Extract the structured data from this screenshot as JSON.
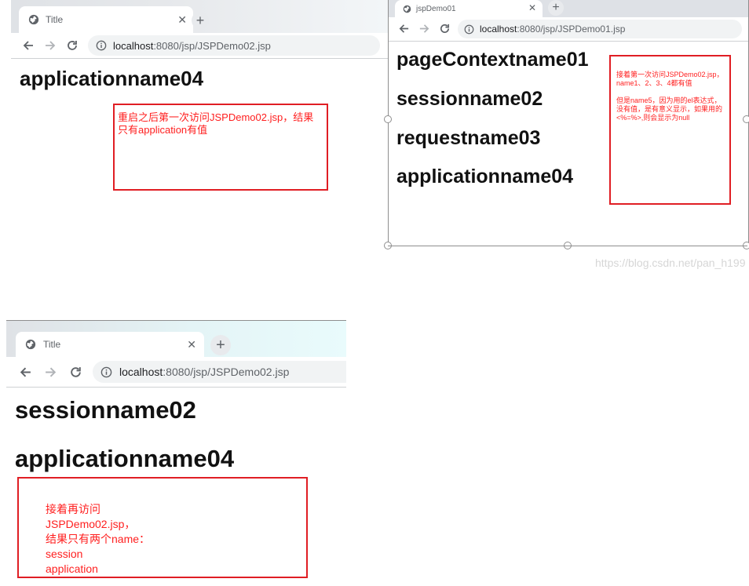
{
  "window_a": {
    "tab_title": "Title",
    "url_host": "localhost",
    "url_rest": ":8080/jsp/JSPDemo02.jsp",
    "headings": [
      "applicationname04"
    ],
    "note": "重启之后第一次访问JSPDemo02.jsp，结果只有application有值"
  },
  "window_b": {
    "tab_title": "jspDemo01",
    "url_host": "localhost",
    "url_rest": ":8080/jsp/JSPDemo01.jsp",
    "headings": [
      "pageContextname01",
      "sessionname02",
      "requestname03",
      "applicationname04"
    ],
    "note_line1": "接着第一次访问JSPDemo02.jsp，name1、2、3、4都有值",
    "note_line2": "但是name5，因为用的el表达式，没有值，是有意义显示，如果用的<%=%>,则会显示为null"
  },
  "window_c": {
    "tab_title": "Title",
    "url_host": "localhost",
    "url_rest": ":8080/jsp/JSPDemo02.jsp",
    "headings": [
      "sessionname02",
      "applicationname04"
    ],
    "note_lines": [
      "接着再访问",
      "JSPDemo02.jsp，",
      "结果只有两个name：",
      "session",
      "application"
    ]
  },
  "watermark": "https://blog.csdn.net/pan_h199",
  "icons": {
    "globe": "globe-icon",
    "close": "close-icon",
    "new_tab": "plus-icon",
    "back": "back-arrow-icon",
    "forward": "forward-arrow-icon",
    "reload": "reload-icon",
    "info": "info-icon"
  },
  "colors": {
    "annotation_border": "#e01e24",
    "annotation_text": "#ff1f1f",
    "tabstrip": "#dee1e6"
  }
}
